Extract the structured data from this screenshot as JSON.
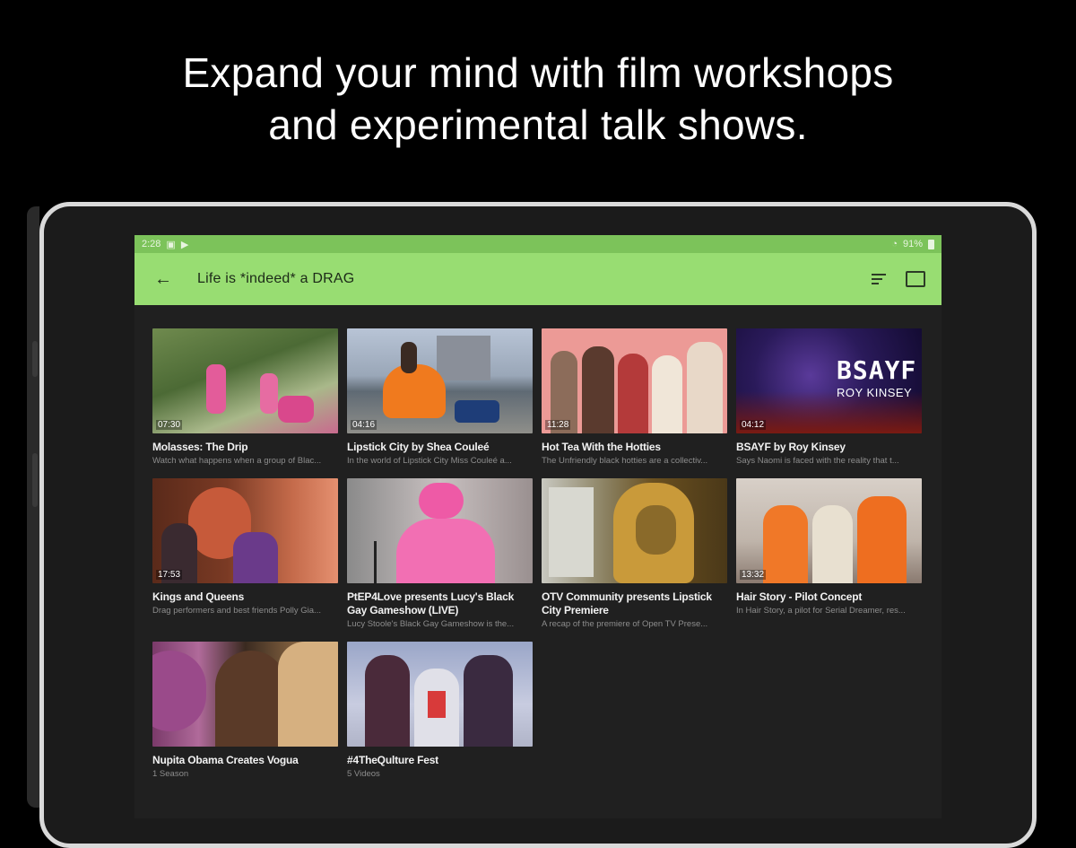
{
  "headline": {
    "line1": "Expand your mind with film workshops",
    "line2": "and experimental talk shows."
  },
  "status": {
    "time": "2:28",
    "battery": "91%"
  },
  "appbar": {
    "title": "Life is *indeed* a DRAG"
  },
  "icons": {
    "back": "arrow-left-icon",
    "sort": "sort-icon",
    "cast": "cast-icon"
  },
  "colors": {
    "statusbar": "#7cc35a",
    "appbar": "#98dd72",
    "background": "#202020"
  },
  "videos": [
    {
      "title": "Molasses: The Drip",
      "desc": "Watch what happens when a group of Blac...",
      "duration": "07:30"
    },
    {
      "title": "Lipstick City by Shea Couleé",
      "desc": "In the world of Lipstick City Miss Couleé a...",
      "duration": "04:16"
    },
    {
      "title": "Hot Tea With the Hotties",
      "desc": "The Unfriendly black hotties are a collectiv...",
      "duration": "11:28"
    },
    {
      "title": "BSAYF by Roy Kinsey",
      "desc": "Says Naomi is faced with the reality that t...",
      "duration": "04:12",
      "overlay1": "BSAYF",
      "overlay2": "ROY KINSEY"
    },
    {
      "title": "Kings and Queens",
      "desc": "Drag performers and best friends Polly Gia...",
      "duration": "17:53"
    },
    {
      "title": "PtEP4Love presents Lucy's Black Gay Gameshow (LIVE)",
      "desc": "Lucy Stoole's Black Gay Gameshow is the...",
      "duration": ""
    },
    {
      "title": "OTV Community presents Lipstick City Premiere",
      "desc": "A recap of the premiere of Open TV Prese...",
      "duration": ""
    },
    {
      "title": "Hair Story - Pilot Concept",
      "desc": "In Hair Story, a pilot for Serial Dreamer, res...",
      "duration": "13:32"
    },
    {
      "title": "Nupita Obama Creates Vogua",
      "desc": "1 Season",
      "duration": ""
    },
    {
      "title": "#4TheQulture Fest",
      "desc": "5 Videos",
      "duration": ""
    }
  ]
}
